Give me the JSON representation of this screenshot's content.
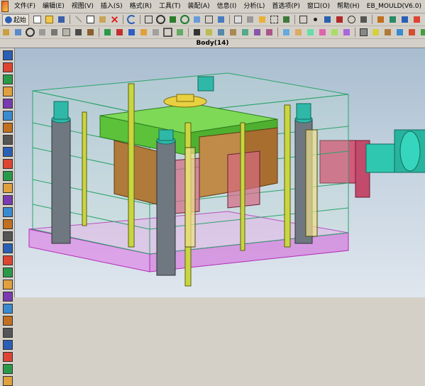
{
  "menu": {
    "items": [
      "文件(F)",
      "编辑(E)",
      "视图(V)",
      "插入(S)",
      "格式(R)",
      "工具(T)",
      "装配(A)",
      "信息(I)",
      "分析(L)",
      "首选项(P)",
      "窗口(O)",
      "帮助(H)",
      "EB_MOULD(V6.0)"
    ]
  },
  "toolbar": {
    "start_label": "起始"
  },
  "viewport": {
    "title": "Body(14)"
  },
  "colors": {
    "ui_gray": "#d4d0c8",
    "plate_edge": "#2aa36a",
    "ejector_plate": "#e07ae6",
    "cavity_green": "#7ed957",
    "core_brown": "#b07a3a",
    "pillar_gray": "#6f7880",
    "nozzle_teal": "#2fc7b0"
  },
  "icons": {
    "sidebar": [
      "cursor-icon",
      "eye-icon",
      "cube-icon",
      "layer-icon",
      "view-icon",
      "fit-icon",
      "zoom-icon",
      "rotate-icon",
      "pan-icon",
      "shade-icon",
      "wire-icon",
      "hide-icon",
      "show-icon",
      "csys-icon",
      "measure-icon",
      "section-icon",
      "render-icon",
      "camera-icon",
      "light-icon",
      "color-icon",
      "settings-icon",
      "info-icon",
      "analysis-icon",
      "tool-icon",
      "mold-icon",
      "part-icon",
      "assembly-icon",
      "grid-icon"
    ]
  }
}
